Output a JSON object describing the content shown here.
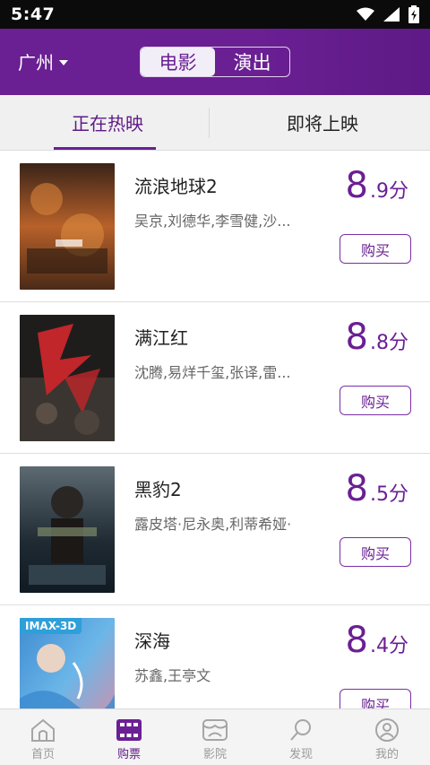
{
  "status": {
    "time": "5:47"
  },
  "header": {
    "city": "广州",
    "segments": [
      "电影",
      "演出"
    ]
  },
  "tabs": [
    "正在热映",
    "即将上映"
  ],
  "movies": [
    {
      "title": "流浪地球2",
      "cast": "吴京,刘德华,李雪健,沙...",
      "score_int": "8",
      "score_dec": ".9分",
      "buy": "购买"
    },
    {
      "title": "满江红",
      "cast": "沈腾,易烊千玺,张译,雷...",
      "score_int": "8",
      "score_dec": ".8分",
      "buy": "购买"
    },
    {
      "title": "黑豹2",
      "cast": "露皮塔·尼永奥,利蒂希娅·",
      "score_int": "8",
      "score_dec": ".5分",
      "buy": "购买"
    },
    {
      "title": "深海",
      "cast": "苏鑫,王亭文",
      "score_int": "8",
      "score_dec": ".4分",
      "buy": "购买",
      "badge": "IMAX-3D"
    }
  ],
  "nav": [
    "首页",
    "购票",
    "影院",
    "发现",
    "我的"
  ],
  "colors": {
    "accent": "#6a1f93",
    "status_bar": "#0b0b0b"
  }
}
